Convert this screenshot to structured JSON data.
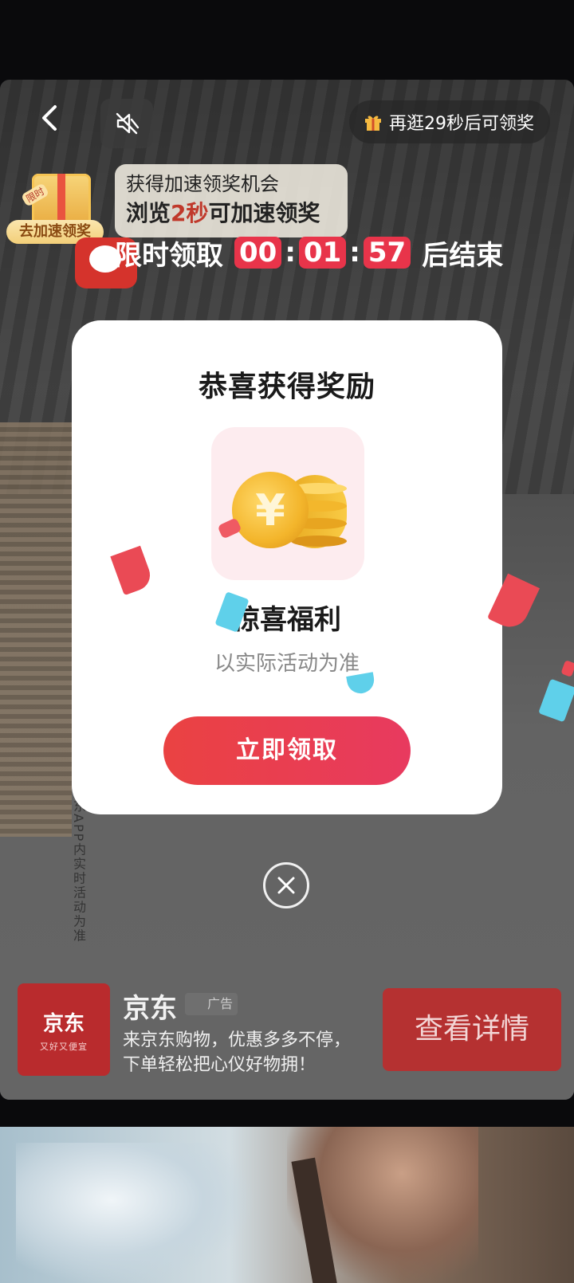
{
  "top_bar": {
    "reward_timer": "再逛29秒后可领奖"
  },
  "speed_badge": {
    "tag": "限时",
    "label": "去加速领奖"
  },
  "promo_tip": {
    "line1": "获得加速领奖机会",
    "line2_prefix": "浏览",
    "line2_highlight": "2秒",
    "line2_suffix": "可加速领奖"
  },
  "countdown": {
    "prefix": "限时领取",
    "hours": "00",
    "minutes": "01",
    "seconds": "57",
    "separator": ":",
    "suffix": "后结束"
  },
  "modal": {
    "title": "恭喜获得奖励",
    "reward_name": "惊喜福利",
    "reward_note": "以实际活动为准",
    "claim_button": "立即领取",
    "coin_symbol": "¥"
  },
  "disclaimer_vertical": "京东APP内实时活动为准",
  "ad": {
    "logo_brand": "京东",
    "logo_slogan": "又好又便宜",
    "name": "京东",
    "tag": "广告",
    "description": "来京东购物，优惠多多不停，下单轻松把心仪好物拥！",
    "cta": "查看详情"
  },
  "colors": {
    "accent_red": "#e8344a",
    "modal_bg": "#ffffff",
    "ad_cta_bg": "#b53131"
  }
}
